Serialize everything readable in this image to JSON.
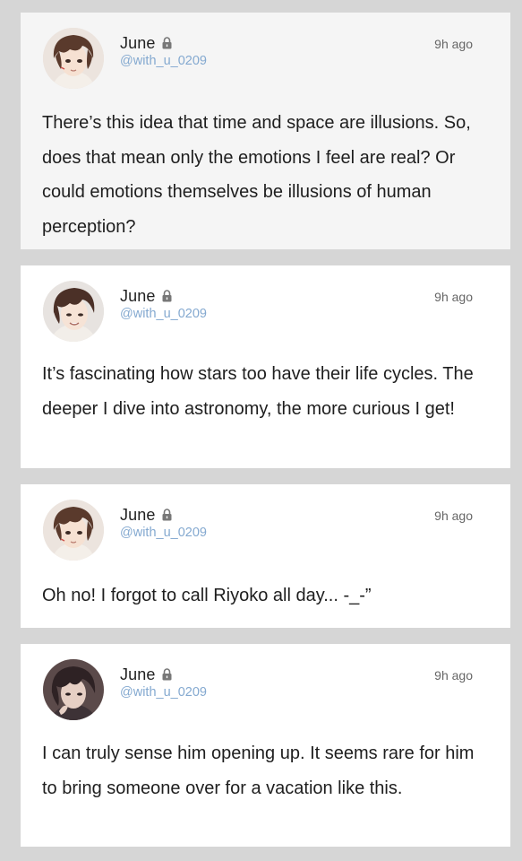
{
  "posts": [
    {
      "author": "June",
      "handle": "@with_u_0209",
      "time": "9h ago",
      "avatar_icon": "character-portrait",
      "lock_icon": "lock-icon",
      "text": "There’s this idea that time and space are illusions. So, does that mean only the emotions I feel are real? Or could emotions themselves be illusions of human perception?"
    },
    {
      "author": "June",
      "handle": "@with_u_0209",
      "time": "9h ago",
      "avatar_icon": "character-portrait",
      "lock_icon": "lock-icon",
      "text": "It’s fascinating how stars too have their life cycles. The deeper I dive into astronomy, the more curious I get!"
    },
    {
      "author": "June",
      "handle": "@with_u_0209",
      "time": "9h ago",
      "avatar_icon": "character-portrait",
      "lock_icon": "lock-icon",
      "text": "Oh no! I forgot to call Riyoko all day... -_-”"
    },
    {
      "author": "June",
      "handle": "@with_u_0209",
      "time": "9h ago",
      "avatar_icon": "character-portrait",
      "lock_icon": "lock-icon",
      "text": "I can truly sense him opening up. It seems rare for him to bring someone over for a vacation like this."
    }
  ],
  "colors": {
    "background": "#d6d6d6",
    "card": "#ffffff",
    "handle": "#84a9d0",
    "text": "#1e1e1e",
    "hair": "#5a3a2c"
  }
}
